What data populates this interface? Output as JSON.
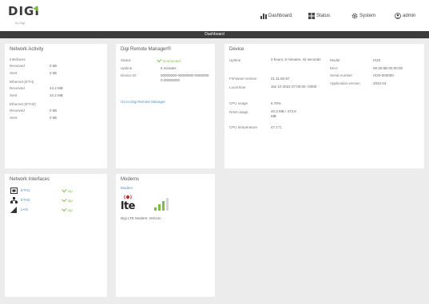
{
  "brand": {
    "name": "DIGI",
    "sub": "by Digi"
  },
  "nav": {
    "dashboard": "Dashboard",
    "status": "Status",
    "system": "System",
    "user": "admin"
  },
  "page_title": "Dashboard",
  "network_activity": {
    "title": "Network Activity",
    "lines": [
      {
        "label": "Interfaces",
        "value": ""
      },
      {
        "label": "Received",
        "value": "0 kB"
      },
      {
        "label": "Sent",
        "value": "0 kB"
      },
      {
        "label": "Ethernet (ETH)",
        "value": ""
      },
      {
        "label": "Received",
        "value": "44.4 MB"
      },
      {
        "label": "Sent",
        "value": "10.2 MB"
      },
      {
        "label": "Ethernet (ETH2)",
        "value": ""
      },
      {
        "label": "Received",
        "value": "0 kB"
      },
      {
        "label": "Sent",
        "value": "0 kB"
      }
    ]
  },
  "remote_manager": {
    "title": "Digi Remote Manager®",
    "status_label": "Status",
    "status_value": "Connected",
    "uptime_label": "Uptime",
    "uptime_value": "5 minutes",
    "device_id_label": "Device ID",
    "device_id_value": "00000000-00000000-00000000-00000000",
    "link": "Go to Digi Remote Manager"
  },
  "device": {
    "title": "Device",
    "left": [
      {
        "label": "Uptime",
        "value": "2 hours, 5 minutes, 44 seconds"
      },
      {
        "label": "Firmware version",
        "value": "21.11.60.97"
      },
      {
        "label": "Local time",
        "value": "Jan 10 2022 07:00:00 +0000"
      },
      {
        "label": "CPU usage",
        "value": "6.78%"
      },
      {
        "label": "RAM usage",
        "value": "40.3 MB / 473.6 MB"
      },
      {
        "label": "CPU temperature",
        "value": "47.1°C"
      }
    ],
    "right": [
      {
        "label": "Model",
        "value": "IX20"
      },
      {
        "label": "MAC",
        "value": "00:40:9D:00:00:00"
      },
      {
        "label": "Serial number",
        "value": "IX20-000000"
      },
      {
        "label": "Application version",
        "value": "2022.04"
      }
    ]
  },
  "interfaces": {
    "title": "Network Interfaces",
    "items": [
      {
        "name": "ETH1",
        "status": "Up"
      },
      {
        "name": "ETH2",
        "status": "Up"
      },
      {
        "name": "LAN",
        "status": "Up"
      }
    ]
  },
  "modems": {
    "title": "Modems",
    "link": "Modem",
    "tech": "LTE",
    "caption": "Digi LTE Modem: Verizon"
  }
}
